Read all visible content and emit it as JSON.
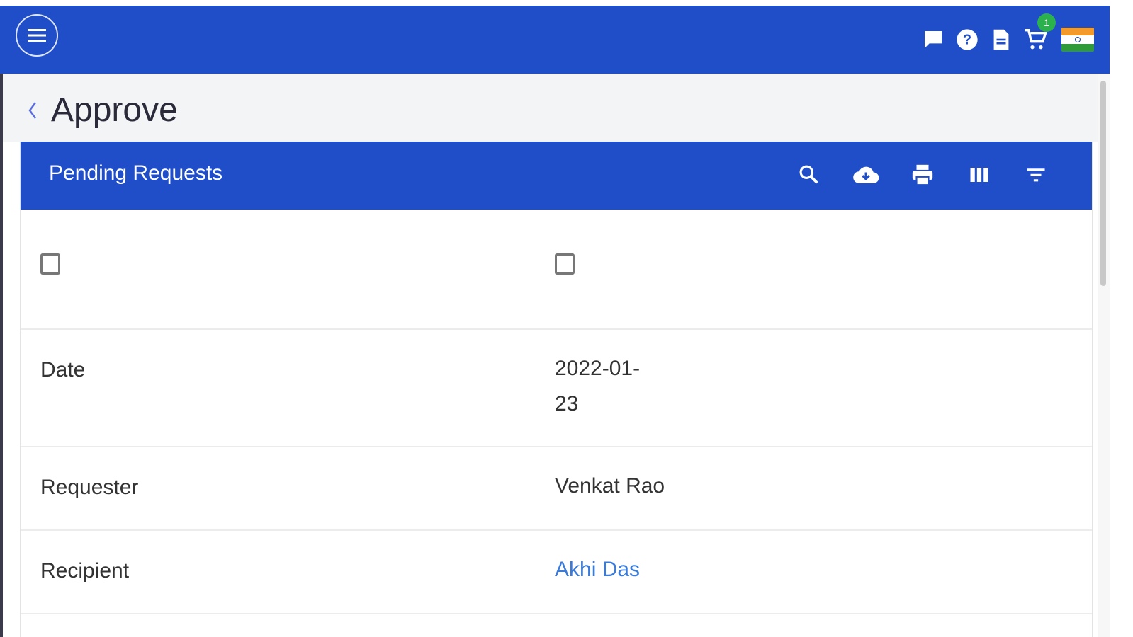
{
  "topbar": {
    "cart_badge": "1",
    "icons": [
      "menu-icon",
      "chat-icon",
      "help-icon",
      "document-icon",
      "cart-icon",
      "india-flag"
    ]
  },
  "page": {
    "title": "Approve"
  },
  "card": {
    "title": "Pending Requests",
    "tools": [
      "search-icon",
      "cloud-download-icon",
      "print-icon",
      "columns-icon",
      "filter-icon"
    ]
  },
  "rows": [
    {
      "label": "Date",
      "value": "2022-01-\n23"
    },
    {
      "label": "Requester",
      "value": "Venkat Rao"
    },
    {
      "label": "Recipient",
      "value": "Akhi Das"
    }
  ],
  "colors": {
    "primary": "#1f4ec8",
    "link": "#3a7ad8",
    "badge": "#2bb24c"
  }
}
